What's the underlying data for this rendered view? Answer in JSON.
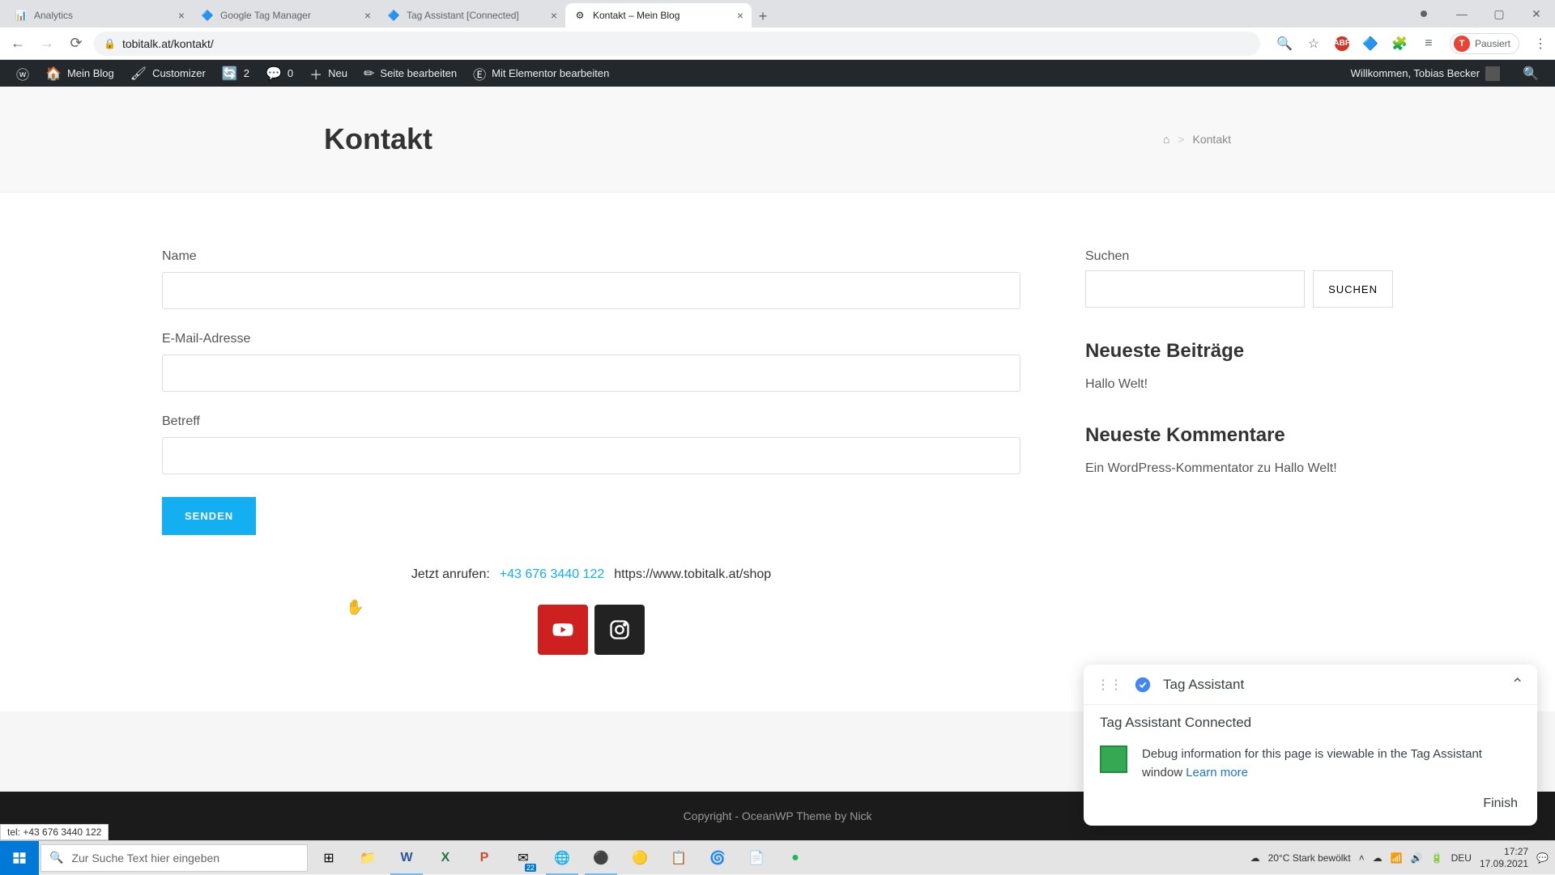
{
  "browser": {
    "tabs": [
      {
        "title": "Analytics",
        "favicon": "📊"
      },
      {
        "title": "Google Tag Manager",
        "favicon": "🔷"
      },
      {
        "title": "Tag Assistant [Connected]",
        "favicon": "🔷"
      },
      {
        "title": "Kontakt – Mein Blog",
        "favicon": "⚙"
      }
    ],
    "url": "tobitalk.at/kontakt/",
    "pause_label": "Pausiert",
    "avatar_letter": "T"
  },
  "wpbar": {
    "site": "Mein Blog",
    "customizer": "Customizer",
    "revisions": "2",
    "comments": "0",
    "new": "Neu",
    "edit": "Seite bearbeiten",
    "elementor": "Mit Elementor bearbeiten",
    "welcome": "Willkommen, Tobias Becker"
  },
  "page": {
    "title": "Kontakt",
    "breadcrumb_current": "Kontakt"
  },
  "form": {
    "name_label": "Name",
    "email_label": "E-Mail-Adresse",
    "subject_label": "Betreff",
    "submit_label": "SENDEN"
  },
  "call": {
    "prefix": "Jetzt anrufen:",
    "phone": "+43 676 3440 122",
    "shop_url": "https://www.tobitalk.at/shop"
  },
  "sidebar": {
    "search_label": "Suchen",
    "search_button": "SUCHEN",
    "recent_posts_title": "Neueste Beiträge",
    "recent_post_1": "Hallo Welt!",
    "recent_comments_title": "Neueste Kommentare",
    "comment_author": "Ein WordPress-Kommentator",
    "comment_on": " zu ",
    "comment_post": "Hallo Welt!"
  },
  "tag_assistant": {
    "title": "Tag Assistant",
    "connected": "Tag Assistant Connected",
    "debug_text": "Debug information for this page is viewable in the Tag Assistant window ",
    "learn_more": "Learn more",
    "finish": "Finish"
  },
  "status_tip": "tel: +43 676 3440 122",
  "footer": "Copyright - OceanWP Theme by Nick",
  "taskbar": {
    "search_placeholder": "Zur Suche Text hier eingeben",
    "weather": "20°C  Stark bewölkt",
    "lang": "DEU",
    "time": "17:27",
    "date": "17.09.2021",
    "calendar_badge": "22"
  }
}
